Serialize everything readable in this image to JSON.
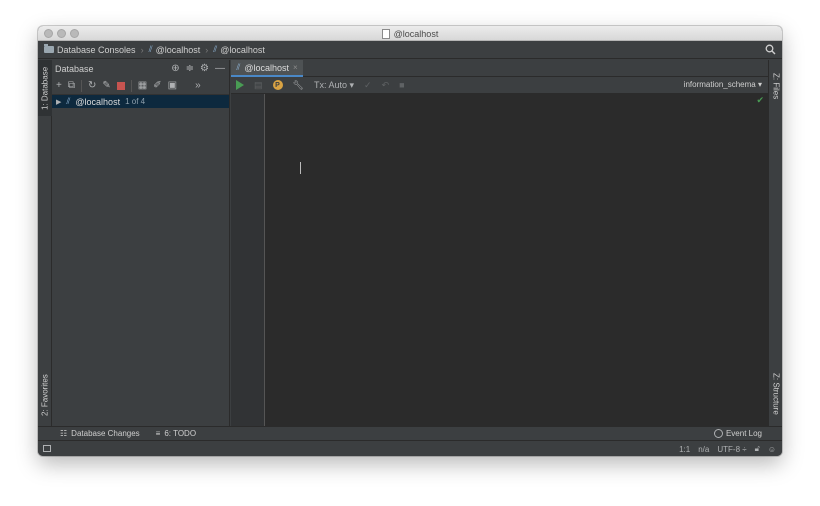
{
  "window": {
    "title": "@localhost"
  },
  "navbar": {
    "crumbs": [
      "Database Consoles",
      "@localhost",
      "@localhost"
    ]
  },
  "left_strip": {
    "database_tab": "1: Database",
    "favorites_tab": "2: Favorites"
  },
  "right_strip": {
    "files_tab": "Z: Files",
    "structure_tab": "Z: Structure"
  },
  "db_panel": {
    "title": "Database",
    "tree": [
      {
        "label": "@localhost",
        "hint": "1 of 4"
      }
    ]
  },
  "editor": {
    "tab_label": "@localhost",
    "tx_label": "Tx: Auto",
    "schema": "information_schema",
    "p_badge": "P"
  },
  "bottom_tabs": {
    "db_changes": "Database Changes",
    "todo": "6: TODO",
    "event_log": "Event Log"
  },
  "status": {
    "position": "1:1",
    "na": "n/a",
    "encoding": "UTF-8 ÷"
  },
  "colors": {
    "accent": "#4a88c7",
    "run": "#499c54",
    "stop": "#c75450",
    "selection": "#0d293e"
  }
}
